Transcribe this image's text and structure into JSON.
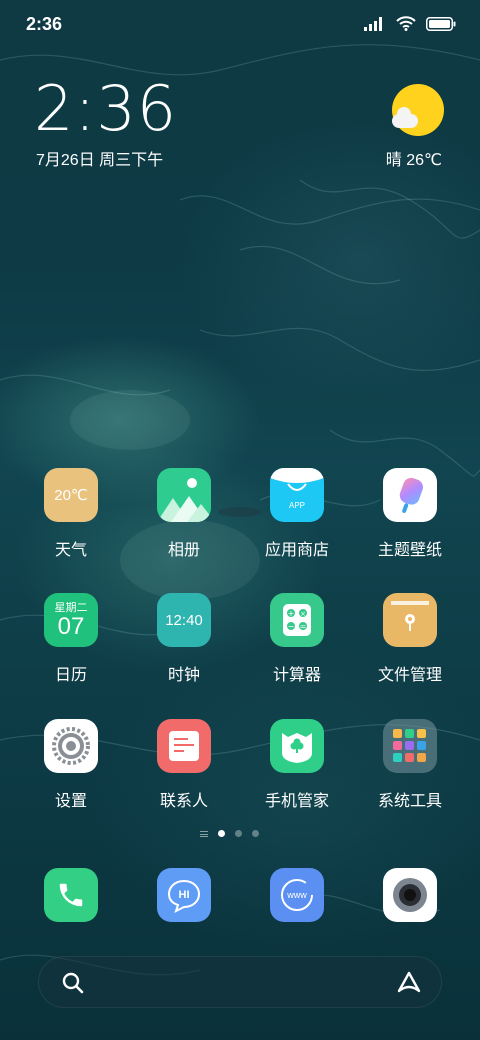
{
  "status_bar": {
    "time": "2:36"
  },
  "clock_widget": {
    "time": "2:36",
    "date": "7月26日 周三下午"
  },
  "weather_widget": {
    "text": "晴 26℃"
  },
  "apps": {
    "weather": {
      "label": "天气",
      "icon_text": "20℃"
    },
    "gallery": {
      "label": "相册"
    },
    "app_store": {
      "label": "应用商店",
      "icon_text": "APP"
    },
    "themes": {
      "label": "主题壁纸"
    },
    "calendar": {
      "label": "日历",
      "icon_top": "星期二",
      "icon_day": "07"
    },
    "clock": {
      "label": "时钟",
      "icon_text": "12:40"
    },
    "calculator": {
      "label": "计算器"
    },
    "file_manager": {
      "label": "文件管理"
    },
    "settings": {
      "label": "设置"
    },
    "contacts": {
      "label": "联系人"
    },
    "security": {
      "label": "手机管家"
    },
    "tools": {
      "label": "系统工具"
    }
  },
  "dock": {
    "messages_icon_text": "HI",
    "browser_icon_text": "www"
  },
  "colors": {
    "weather_icon": "#e9c27d",
    "gallery_icon": "#2ecc8f",
    "app_store_icon": "#1ec8f5",
    "calendar_icon": "#1fc17c",
    "clock_icon": "#2fb5b0",
    "calculator_icon": "#37c98c",
    "file_manager_icon": "#e8b866",
    "contacts_icon": "#f26b6b",
    "security_icon": "#2fcf8a",
    "phone_icon": "#33cf85",
    "messages_icon": "#5e9cf5",
    "browser_icon": "#5b8ff2"
  }
}
